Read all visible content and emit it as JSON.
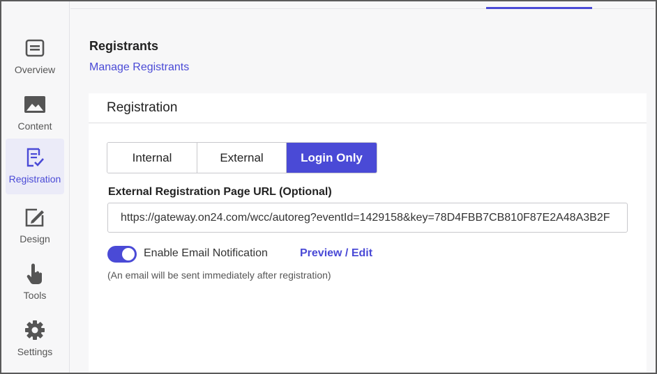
{
  "sidebar": {
    "items": [
      {
        "label": "Overview",
        "icon": "overview-icon"
      },
      {
        "label": "Content",
        "icon": "image-icon"
      },
      {
        "label": "Registration",
        "icon": "registration-icon",
        "active": true
      },
      {
        "label": "Design",
        "icon": "design-icon"
      },
      {
        "label": "Tools",
        "icon": "hand-pointer-icon"
      },
      {
        "label": "Settings",
        "icon": "gear-icon"
      }
    ]
  },
  "registrants": {
    "title": "Registrants",
    "manage_link": "Manage Registrants"
  },
  "registration_card": {
    "title": "Registration",
    "segments": [
      "Internal",
      "External",
      "Login Only"
    ],
    "selected_segment": "Login Only",
    "url_label": "External Registration Page URL (Optional)",
    "url_value": "https://gateway.on24.com/wcc/autoreg?eventId=1429158&key=78D4FBB7CB810F87E2A48A3B2F",
    "email_toggle_label": "Enable Email Notification",
    "email_toggle_on": true,
    "preview_link": "Preview / Edit",
    "hint": "(An email will be sent immediately after registration)"
  },
  "colors": {
    "accent": "#4a4ad6",
    "active_nav_bg": "#ebebf8"
  }
}
